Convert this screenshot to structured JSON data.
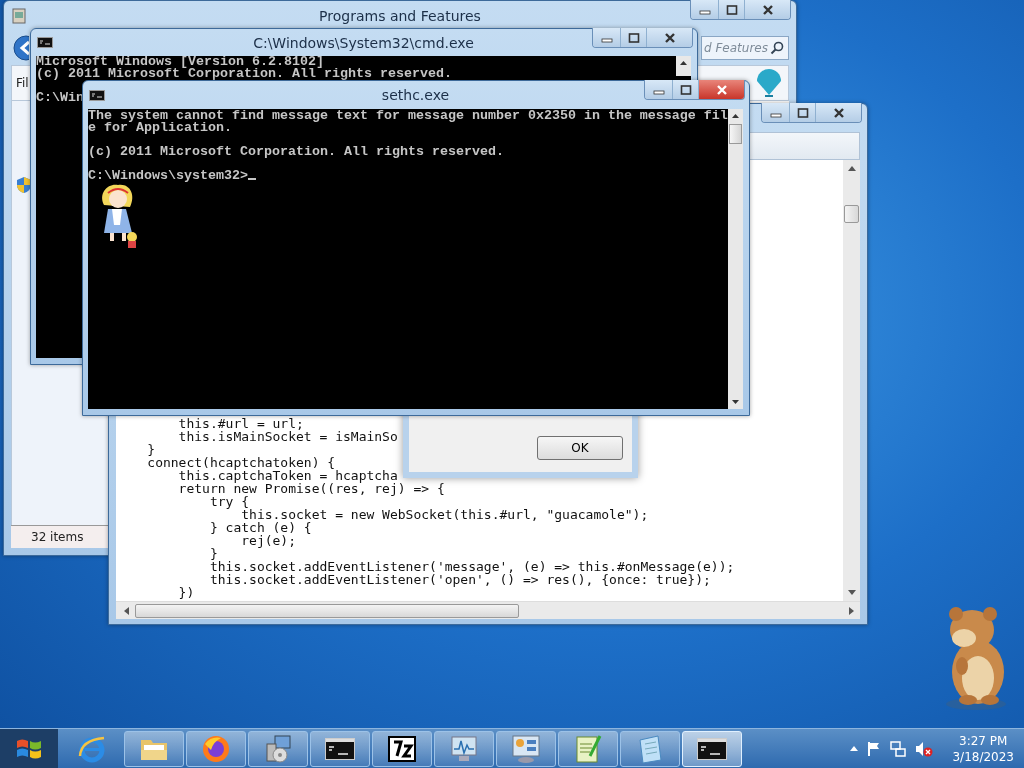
{
  "programs_window": {
    "title": "Programs and Features",
    "search": {
      "placeholder": "d Features"
    },
    "menu": [
      "Fil"
    ],
    "status_bar": "32 items"
  },
  "editor_window": {
    "code_lines": [
      "        this.#url = url;",
      "        this.isMainSocket = isMainSo",
      "    }",
      "    connect(hcaptchatoken) {",
      "        this.captchaToken = hcaptcha",
      "        return new Promise((res, rej) => {",
      "            try {",
      "                this.socket = new WebSocket(this.#url, \"guacamole\");",
      "            } catch (e) {",
      "                rej(e);",
      "            }",
      "            this.socket.addEventListener('message', (e) => this.#onMessage(e));",
      "            this.socket.addEventListener('open', () => res(), {once: true});",
      "        })"
    ]
  },
  "dialog": {
    "buttons": [
      "OK"
    ]
  },
  "cmd_window": {
    "title": "C:\\Windows\\System32\\cmd.exe",
    "blocks": [
      [
        "Microsoft Windows [Version 6.2.8102]",
        "(c) 2011 Microsoft Corporation. All rights reserved."
      ],
      [
        "C:\\Win"
      ]
    ]
  },
  "sethc_window": {
    "title": "sethc.exe",
    "blocks": [
      [
        "The system cannot find message text for message number 0x2350 in the message fil",
        "e for Application."
      ],
      [
        "(c) 2011 Microsoft Corporation. All rights reserved."
      ],
      [
        "C:\\Windows\\system32>"
      ]
    ],
    "cursor": true
  },
  "taskbar": {
    "items": [
      {
        "kind": "browser",
        "running": false,
        "selected": false
      },
      {
        "kind": "folder",
        "running": true,
        "selected": false
      },
      {
        "kind": "firefox",
        "running": true,
        "selected": false
      },
      {
        "kind": "installer",
        "running": true,
        "selected": false
      },
      {
        "kind": "console",
        "running": true,
        "selected": false
      },
      {
        "kind": "archiver",
        "running": true,
        "selected": false
      },
      {
        "kind": "monitor",
        "running": true,
        "selected": false
      },
      {
        "kind": "control",
        "running": true,
        "selected": false
      },
      {
        "kind": "editor",
        "running": true,
        "selected": false
      },
      {
        "kind": "notepad",
        "running": true,
        "selected": false
      },
      {
        "kind": "console",
        "running": true,
        "selected": true
      }
    ],
    "time": "3:27 PM",
    "date": "3/18/2023"
  }
}
